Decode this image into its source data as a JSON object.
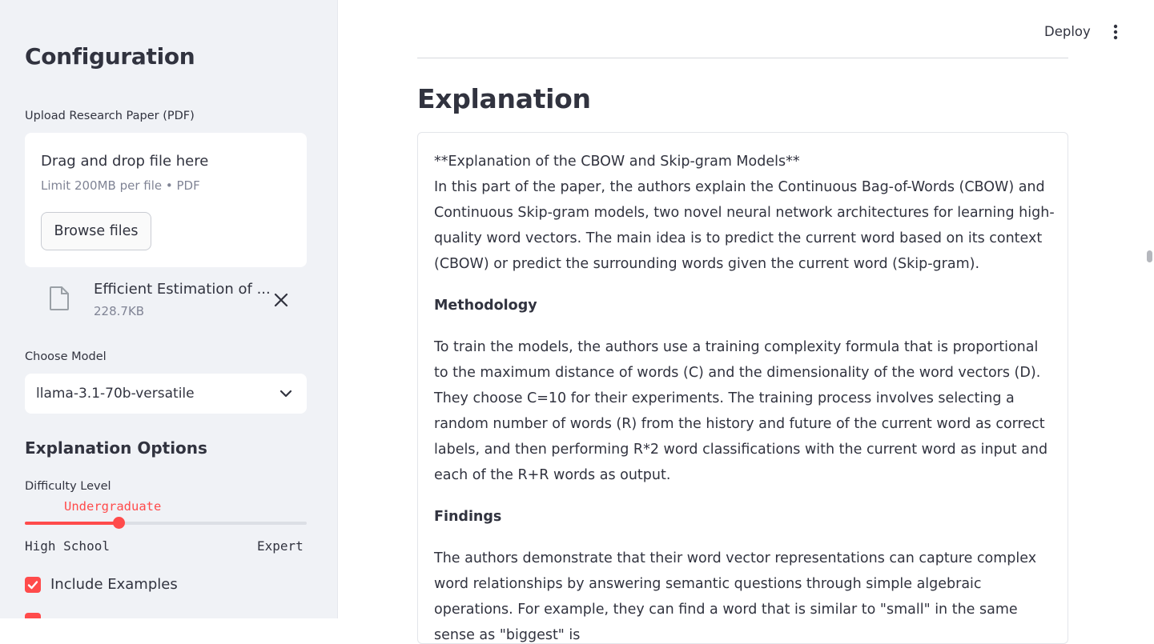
{
  "sidebar": {
    "title": "Configuration",
    "upload": {
      "label": "Upload Research Paper (PDF)",
      "drop_text": "Drag and drop file here",
      "limit_text": "Limit 200MB per file • PDF",
      "browse_label": "Browse files"
    },
    "file": {
      "name": "Efficient Estimation of ...",
      "size": "228.7KB",
      "icon": "file-icon"
    },
    "model": {
      "label": "Choose Model",
      "selected": "llama-3.1-70b-versatile"
    },
    "options": {
      "heading": "Explanation Options",
      "difficulty": {
        "label": "Difficulty Level",
        "value": "Undergraduate",
        "min_label": "High School",
        "max_label": "Expert",
        "level_fraction": 0.33
      },
      "include_examples": {
        "label": "Include Examples",
        "checked": true
      }
    }
  },
  "toolbar": {
    "deploy_label": "Deploy",
    "menu_icon": "vertical-dots-icon"
  },
  "main": {
    "title": "Explanation",
    "intro_heading": "**Explanation of the CBOW and Skip-gram Models**",
    "intro": "In this part of the paper, the authors explain the Continuous Bag-of-Words (CBOW) and Continuous Skip-gram models, two novel neural network architectures for learning high-quality word vectors. The main idea is to predict the current word based on its context (CBOW) or predict the surrounding words given the current word (Skip-gram).",
    "methodology_heading": "Methodology",
    "methodology": "To train the models, the authors use a training complexity formula that is proportional to the maximum distance of words (C) and the dimensionality of the word vectors (D). They choose C=10 for their experiments. The training process involves selecting a random number of words (R) from the history and future of the current word as correct labels, and then performing R*2 word classifications with the current word as input and each of the R+R words as output.",
    "findings_heading": "Findings",
    "findings": "The authors demonstrate that their word vector representations can capture complex word relationships by answering semantic questions through simple algebraic operations. For example, they can find a word that is similar to \"small\" in the same sense as \"biggest\" is"
  },
  "colors": {
    "accent": "#ff4b4b",
    "sidebar_bg": "#f0f2f6",
    "text": "#31333f",
    "muted": "#808495"
  }
}
